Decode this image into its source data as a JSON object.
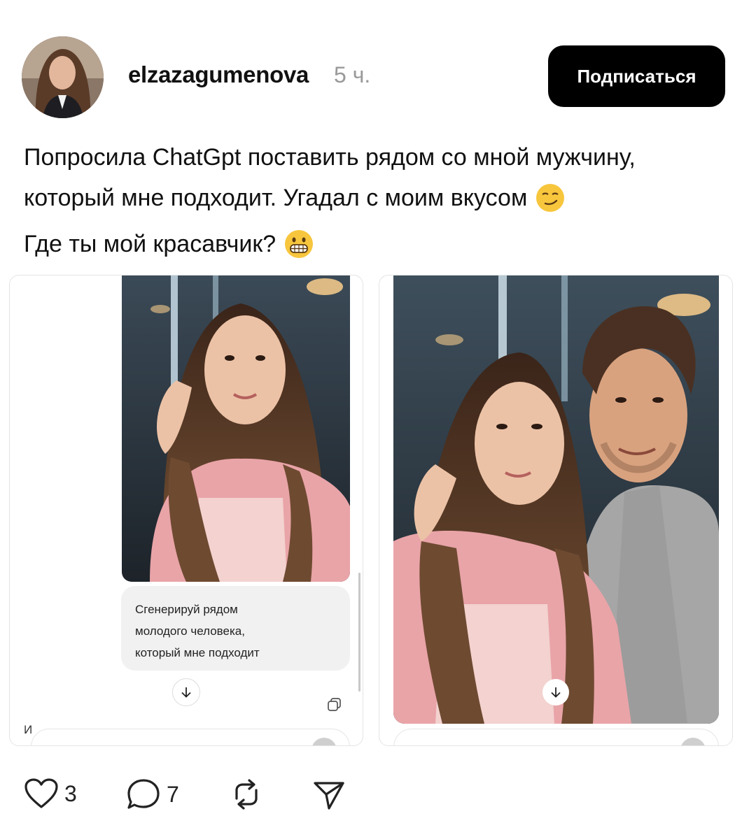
{
  "post": {
    "username": "elzazagumenova",
    "time": "5 ч.",
    "subscribe_label": "Подписаться",
    "caption_line1": "Попросила ChatGpt поставить рядом со мной мужчину,",
    "caption_line2": "который мне подходит. Угадал с моим вкусом",
    "caption_line2_emoji": "smirking-face-emoji",
    "caption_para2": "Где ты мой красавчик?",
    "caption_para2_emoji": "grinning-face-emoji"
  },
  "carousel": {
    "slide1": {
      "chat_bubble": [
        "Сгенерируй рядом",
        "молодого человека,",
        "который мне подходит"
      ],
      "input_stub": "И"
    }
  },
  "actions": {
    "likes": "3",
    "comments": "7",
    "like_icon": "heart-icon",
    "comment_icon": "comment-icon",
    "repost_icon": "repost-icon",
    "share_icon": "send-icon"
  },
  "colors": {
    "button_bg": "#000000",
    "muted": "#999999",
    "shirt_pink": "#e9a4a8",
    "hair": "#4a3022"
  }
}
